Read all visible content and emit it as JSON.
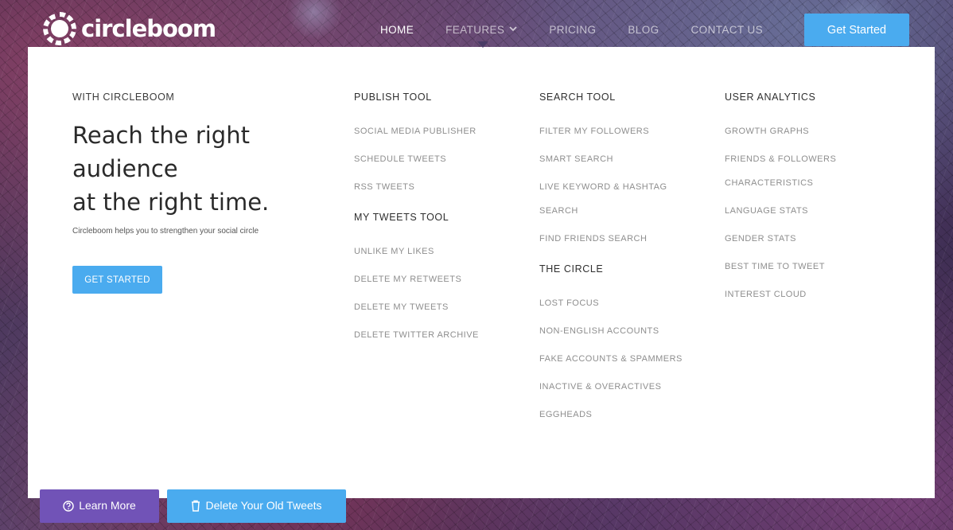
{
  "brand": {
    "name": "circleboom"
  },
  "nav": {
    "items": [
      {
        "label": "HOME",
        "active": true
      },
      {
        "label": "FEATURES",
        "active": false,
        "has_dropdown": true
      },
      {
        "label": "PRICING",
        "active": false
      },
      {
        "label": "BLOG",
        "active": false
      },
      {
        "label": "CONTACT US",
        "active": false
      }
    ],
    "cta_label": "Get Started"
  },
  "mega_menu": {
    "intro": {
      "kicker": "WITH CIRCLEBOOM",
      "title": "Reach the right\naudience\nat the right time.",
      "subtitle": "Circleboom helps you to strengthen your social circle",
      "button_label": "GET STARTED"
    },
    "columns": [
      {
        "groups": [
          {
            "heading": "PUBLISH TOOL",
            "links": [
              "SOCIAL MEDIA PUBLISHER",
              "SCHEDULE TWEETS",
              "RSS TWEETS"
            ]
          },
          {
            "heading": "MY TWEETS TOOL",
            "links": [
              "UNLIKE MY LIKES",
              "DELETE MY RETWEETS",
              "DELETE MY TWEETS",
              "DELETE TWITTER ARCHIVE"
            ]
          }
        ]
      },
      {
        "groups": [
          {
            "heading": "SEARCH TOOL",
            "links": [
              "FILTER MY FOLLOWERS",
              "SMART SEARCH",
              "LIVE KEYWORD & HASHTAG SEARCH",
              "FIND FRIENDS SEARCH"
            ]
          },
          {
            "heading": "THE CIRCLE",
            "links": [
              "LOST FOCUS",
              "NON-ENGLISH ACCOUNTS",
              "FAKE ACCOUNTS & SPAMMERS",
              "INACTIVE & OVERACTIVES",
              "EGGHEADS"
            ]
          }
        ]
      },
      {
        "groups": [
          {
            "heading": "USER ANALYTICS",
            "links": [
              "GROWTH GRAPHS",
              "FRIENDS & FOLLOWERS CHARACTERISTICS",
              "LANGUAGE STATS",
              "GENDER STATS",
              "BEST TIME TO TWEET",
              "INTEREST CLOUD"
            ]
          }
        ]
      }
    ]
  },
  "hero_buttons": {
    "learn_more": "Learn More",
    "delete_tweets": "Delete Your Old Tweets"
  },
  "colors": {
    "accent_blue": "#4aabef",
    "accent_purple": "#7153b7",
    "menu_link": "#8e8e8e",
    "menu_heading": "#2f2f2f"
  },
  "icons": {
    "brand": "circleboom-logo-icon",
    "features_dropdown": "chevron-down-icon",
    "learn_more": "question-circle-icon",
    "delete_tweets": "trash-icon"
  }
}
